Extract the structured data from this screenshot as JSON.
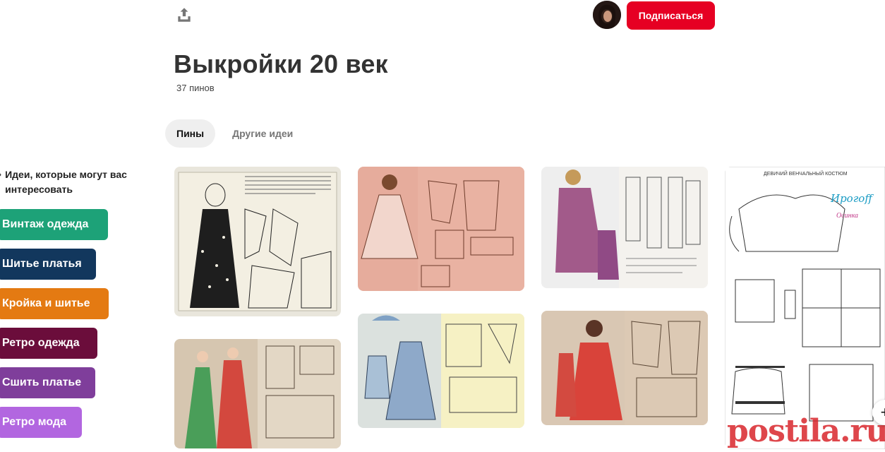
{
  "header": {
    "share_icon": "share-upload-icon",
    "subscribe_label": "Подписаться",
    "accent_color": "#e60023"
  },
  "board": {
    "title": "Выкройки 20 век",
    "pin_count": "37 пинов"
  },
  "tabs": [
    {
      "label": "Пины",
      "active": true
    },
    {
      "label": "Другие идеи",
      "active": false
    }
  ],
  "ideas": {
    "title": "Идеи, которые могут вас интересовать",
    "chips": [
      {
        "label": "Винтаж одежда",
        "color": "#1da278"
      },
      {
        "label": "Шитье платья",
        "color": "#12375d"
      },
      {
        "label": "Кройка и шитье",
        "color": "#e47a12"
      },
      {
        "label": "Ретро одежда",
        "color": "#6b0d3b"
      },
      {
        "label": "Сшить платье",
        "color": "#7f3e9b"
      },
      {
        "label": "Ретро мода",
        "color": "#b266e0"
      }
    ]
  },
  "pins": {
    "pin4_header_text": "ДЕВИЧИЙ ВЕНЧАЛЬНЫЙ КОСТЮМ",
    "pin4_brand": "Ирогoff",
    "pin4_sub": "Осинка"
  },
  "watermark": "postila.ru",
  "scroll_icon": "plus-icon"
}
